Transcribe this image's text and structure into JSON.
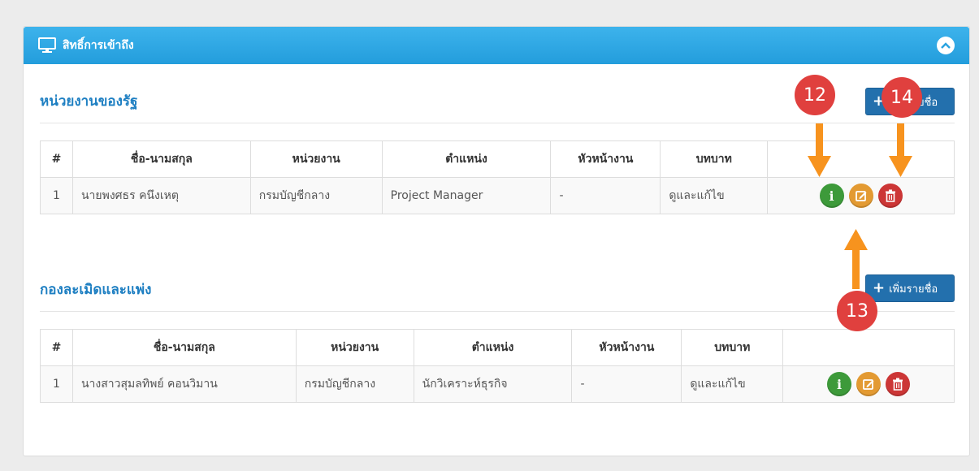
{
  "panel": {
    "title": "สิทธิ์การเข้าถึง",
    "icon": "monitor-icon",
    "collapse_icon": "chevron-up-icon"
  },
  "sections": [
    {
      "title": "หน่วยงานของรัฐ",
      "add_button_label": "เพิ่มรายชื่อ",
      "columns": [
        "#",
        "ชื่อ-นามสกุล",
        "หน่วยงาน",
        "ตำแหน่ง",
        "หัวหน้างาน",
        "บทบาท",
        ""
      ],
      "rows": [
        {
          "num": "1",
          "name": "นายพงศธร คนึงเหตุ",
          "agency": "กรมบัญชีกลาง",
          "position": "Project Manager",
          "supervisor": "-",
          "role": "ดูและแก้ไข"
        }
      ]
    },
    {
      "title": "กองละเมิดและแพ่ง",
      "add_button_label": "เพิ่มรายชื่อ",
      "columns": [
        "#",
        "ชื่อ-นามสกุล",
        "หน่วยงาน",
        "ตำแหน่ง",
        "หัวหน้างาน",
        "บทบาท",
        ""
      ],
      "rows": [
        {
          "num": "1",
          "name": "นางสาวสุมลทิพย์ คอนวิมาน",
          "agency": "กรมบัญชีกลาง",
          "position": "นักวิเคราะห์ธุรกิจ",
          "supervisor": "-",
          "role": "ดูและแก้ไข"
        }
      ]
    }
  ],
  "action_icons": {
    "info": "i",
    "edit": "edit-icon",
    "delete": "trash-icon"
  },
  "annotations": {
    "info_marker": "12",
    "edit_marker": "13",
    "delete_marker": "14"
  },
  "colors": {
    "header": "#2aa3e0",
    "section_title": "#1e7fc2",
    "add_button": "#2370ad",
    "info": "#3d9a3a",
    "edit": "#e39a32",
    "delete": "#cc3636",
    "badge": "#e0403e",
    "arrow": "#f7931e"
  }
}
